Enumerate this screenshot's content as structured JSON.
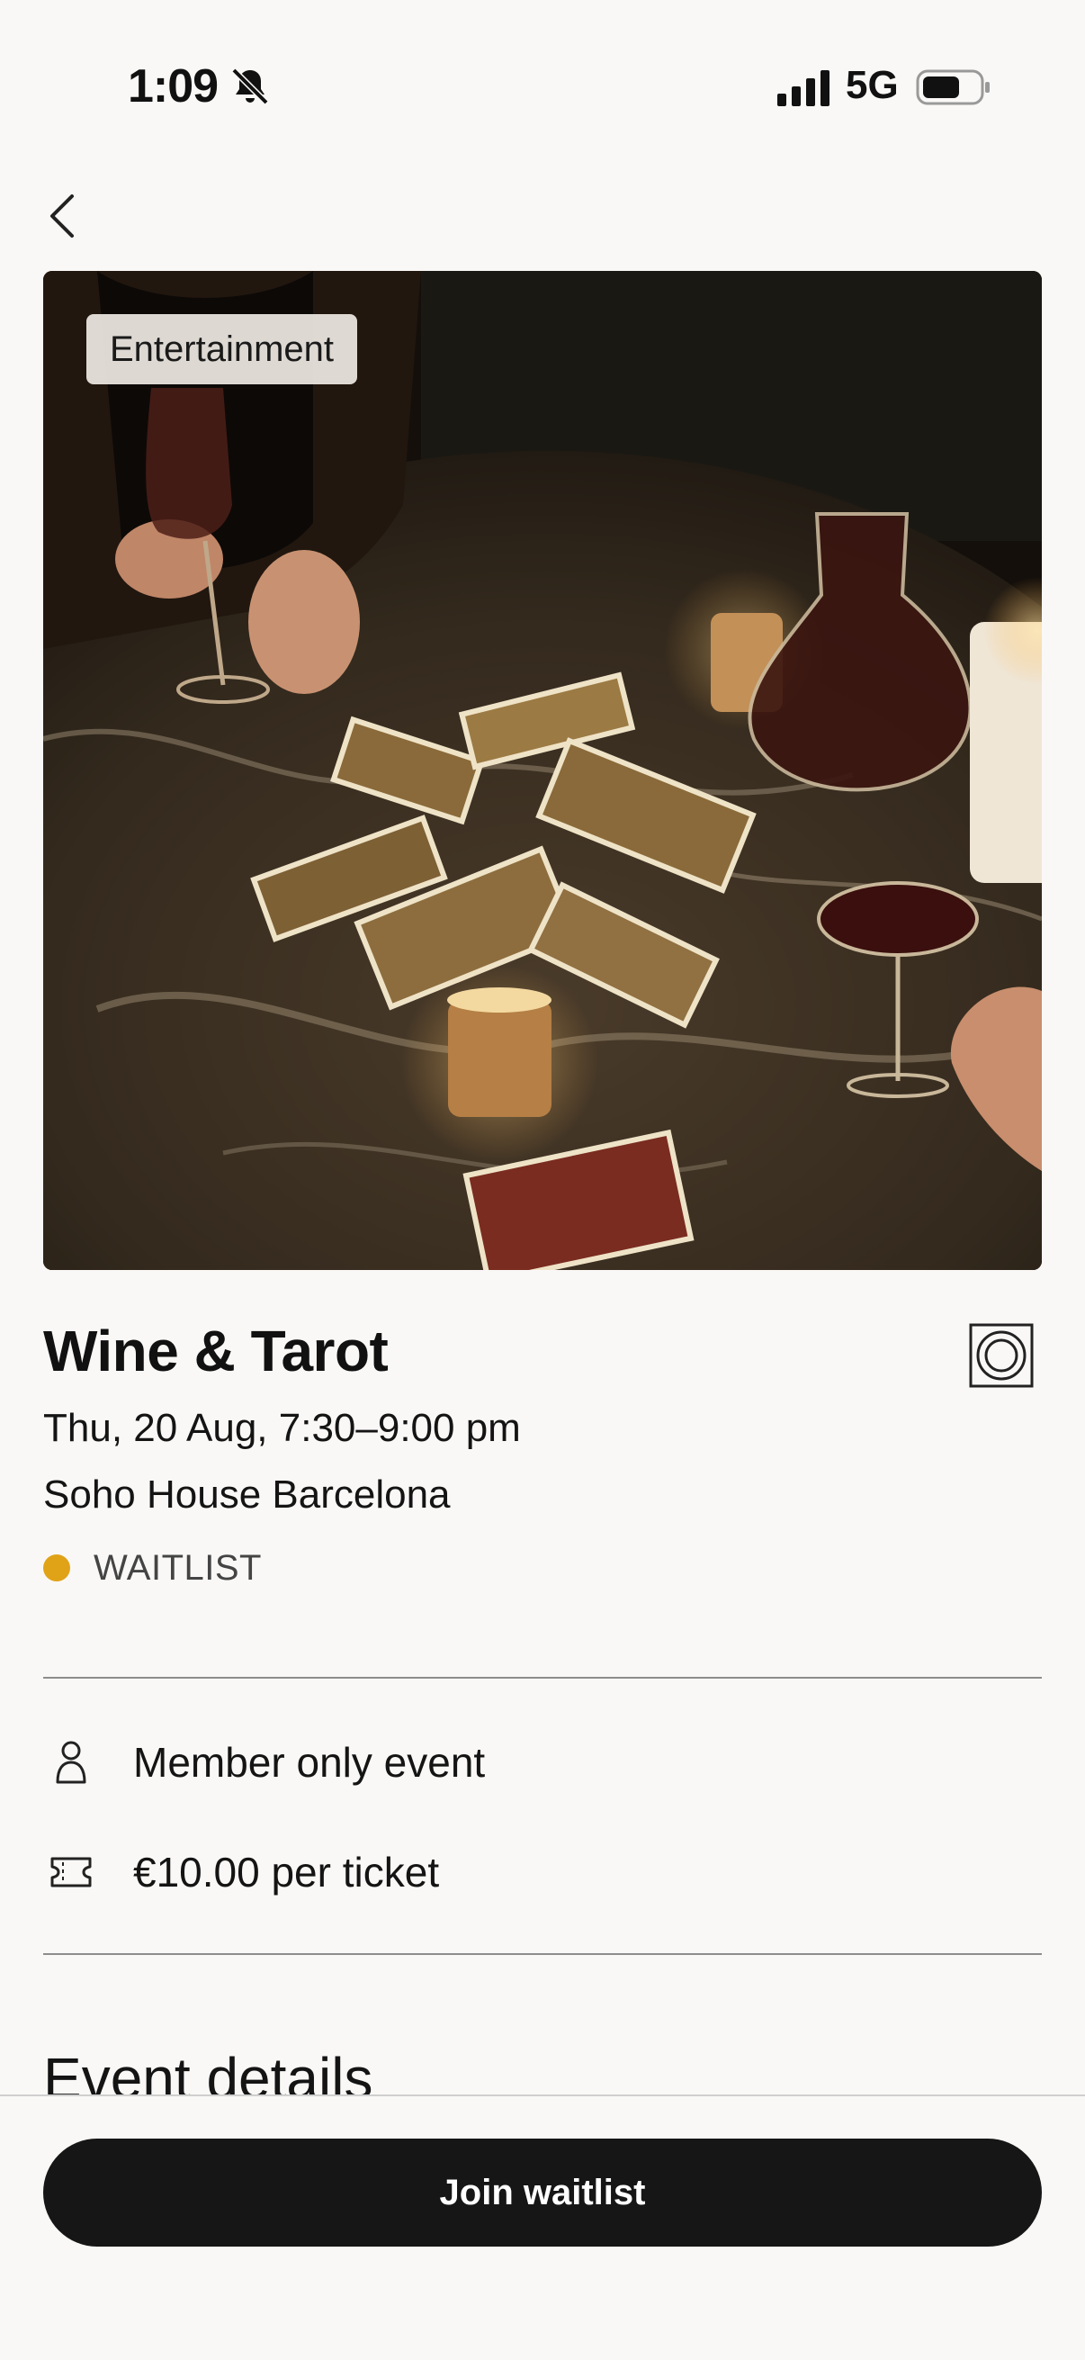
{
  "status_bar": {
    "time": "1:09",
    "network": "5G"
  },
  "event": {
    "category": "Entertainment",
    "title": "Wine & Tarot",
    "datetime": "Thu, 20 Aug, 7:30–9:00 pm",
    "venue": "Soho House Barcelona",
    "status": "WAITLIST",
    "status_color": "#e0a318"
  },
  "info": {
    "membership": "Member only event",
    "price": "€10.00 per ticket"
  },
  "section": {
    "event_details_title": "Event details"
  },
  "cta": {
    "join_label": "Join waitlist"
  },
  "icons": {
    "back": "chevron-left-icon",
    "bell_muted": "bell-slash-icon",
    "signal": "signal-bars-icon",
    "battery": "battery-icon",
    "qr": "concentric-circles-icon",
    "member": "person-icon",
    "ticket": "ticket-icon"
  }
}
